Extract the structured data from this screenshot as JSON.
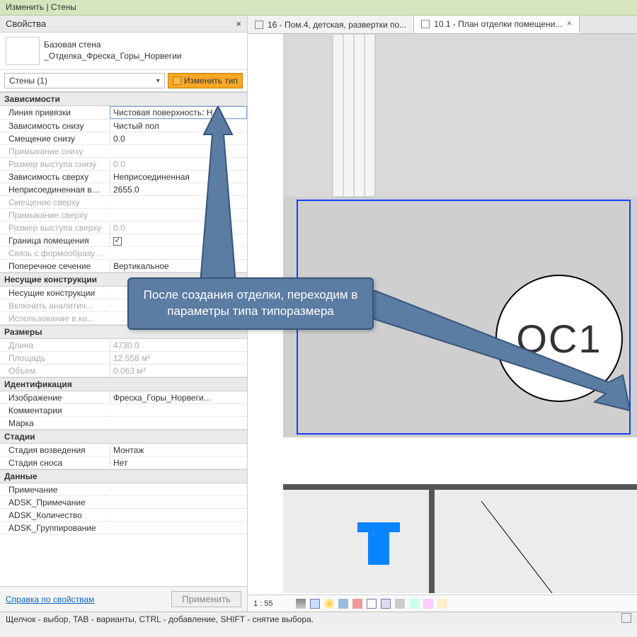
{
  "titlebar": "Изменить | Стены",
  "panel": {
    "title": "Свойства",
    "family_line1": "Базовая стена",
    "family_line2": "_Отделка_Фреска_Горы_Норвегии",
    "selector": "Стены (1)",
    "edit_type": "Изменить тип",
    "help_link": "Справка по свойствам",
    "apply": "Применить"
  },
  "props": [
    {
      "type": "group",
      "label": "Зависимости"
    },
    {
      "type": "row",
      "k": "Линия привязки",
      "v": "Чистовая поверхность: Н",
      "active": true
    },
    {
      "type": "row",
      "k": "Зависимость снизу",
      "v": "Чистый пол"
    },
    {
      "type": "row",
      "k": "Смещение снизу",
      "v": "0.0"
    },
    {
      "type": "row",
      "k": "Примыкание снизу",
      "v": "",
      "disabled": true
    },
    {
      "type": "row",
      "k": "Размер выступа снизу",
      "v": "0.0",
      "disabled": true
    },
    {
      "type": "row",
      "k": "Зависимость сверху",
      "v": "Неприсоединенная"
    },
    {
      "type": "row",
      "k": "Неприсоединенная выс...",
      "v": "2655.0"
    },
    {
      "type": "row",
      "k": "Смещение сверху",
      "v": "",
      "disabled": true
    },
    {
      "type": "row",
      "k": "Примыкание сверху",
      "v": "",
      "disabled": true
    },
    {
      "type": "row",
      "k": "Размер выступа сверху",
      "v": "0.0",
      "disabled": true
    },
    {
      "type": "row",
      "k": "Граница помещения",
      "v": "☑",
      "check": true
    },
    {
      "type": "row",
      "k": "Связь с формообразую...",
      "v": "",
      "disabled": true
    },
    {
      "type": "row",
      "k": "Поперечное сечение",
      "v": "Вертикальное"
    },
    {
      "type": "group",
      "label": "Несущие конструкции"
    },
    {
      "type": "row",
      "k": "Несущие конструкции",
      "v": ""
    },
    {
      "type": "row",
      "k": "Включить аналитич...",
      "v": "",
      "disabled": true
    },
    {
      "type": "row",
      "k": "Использование в ко...",
      "v": "",
      "disabled": true
    },
    {
      "type": "group",
      "label": "Размеры"
    },
    {
      "type": "row",
      "k": "Длина",
      "v": "4730.0",
      "disabled": true
    },
    {
      "type": "row",
      "k": "Площадь",
      "v": "12.558 м²",
      "disabled": true
    },
    {
      "type": "row",
      "k": "Объем",
      "v": "0.063 м³",
      "disabled": true
    },
    {
      "type": "group",
      "label": "Идентификация"
    },
    {
      "type": "row",
      "k": "Изображение",
      "v": "Фреска_Горы_Норвеги..."
    },
    {
      "type": "row",
      "k": "Комментарии",
      "v": ""
    },
    {
      "type": "row",
      "k": "Марка",
      "v": ""
    },
    {
      "type": "group",
      "label": "Стадии"
    },
    {
      "type": "row",
      "k": "Стадия возведения",
      "v": "Монтаж"
    },
    {
      "type": "row",
      "k": "Стадия сноса",
      "v": "Нет"
    },
    {
      "type": "group",
      "label": "Данные"
    },
    {
      "type": "row",
      "k": "Примечание",
      "v": ""
    },
    {
      "type": "row",
      "k": "ADSK_Примечание",
      "v": ""
    },
    {
      "type": "row",
      "k": "ADSK_Количество",
      "v": ""
    },
    {
      "type": "row",
      "k": "ADSK_Группирование",
      "v": ""
    }
  ],
  "tabs": [
    {
      "label": "16 - Пом.4, детская, развертки по...",
      "active": false
    },
    {
      "label": "10.1 - План отделки помещени...",
      "active": true
    }
  ],
  "callout": "После создания отделки, переходим в параметры типа типоразмера",
  "room_tag": "ОС1",
  "viewbar": {
    "scale": "1 : 55"
  },
  "status": "Щелчок - выбор, TAB - варианты, CTRL - добавление, SHIFT - снятие выбора."
}
